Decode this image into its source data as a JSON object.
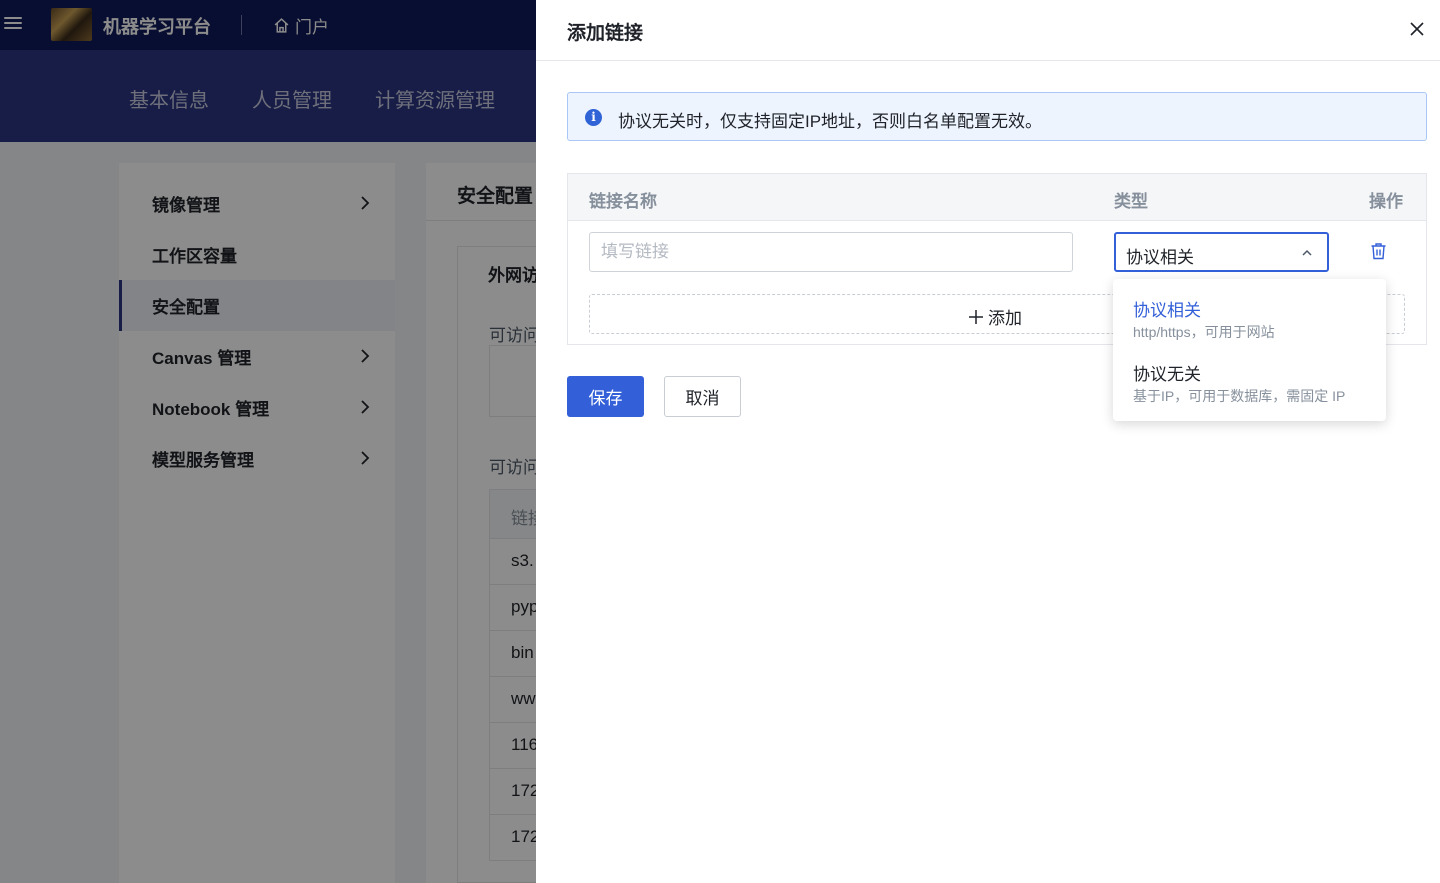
{
  "topbar": {
    "app_name": "机器学习平台",
    "portal_label": "门户"
  },
  "subnav": {
    "items": [
      "基本信息",
      "人员管理",
      "计算资源管理"
    ]
  },
  "sidebar": {
    "items": [
      {
        "label": "镜像管理",
        "has_children": true
      },
      {
        "label": "工作区容量",
        "has_children": false
      },
      {
        "label": "安全配置",
        "has_children": false,
        "active": true
      },
      {
        "label": "Canvas 管理",
        "has_children": true
      },
      {
        "label": "Notebook 管理",
        "has_children": true
      },
      {
        "label": "模型服务管理",
        "has_children": true
      }
    ]
  },
  "content": {
    "title": "安全配置",
    "card_title": "外网访",
    "label1": "可访问",
    "label2": "可访问",
    "table_header": "链接",
    "rows": [
      "s3.",
      "pyp",
      "bin",
      "ww",
      "116",
      "172",
      "172"
    ]
  },
  "drawer": {
    "title": "添加链接",
    "alert_text": "协议无关时，仅支持固定IP地址，否则白名单配置无效。",
    "columns": {
      "name": "链接名称",
      "type": "类型",
      "action": "操作"
    },
    "name_placeholder": "填写链接",
    "name_value": "",
    "type_value": "协议相关",
    "add_label": "添加",
    "save_label": "保存",
    "cancel_label": "取消",
    "options": [
      {
        "title": "协议相关",
        "desc": "http/https，可用于网站",
        "selected": true
      },
      {
        "title": "协议无关",
        "desc": "基于IP，可用于数据库，需固定 IP",
        "selected": false
      }
    ]
  },
  "colors": {
    "primary": "#3360d8",
    "topbar": "#101a5a",
    "subnav": "#2b3580"
  },
  "icons": [
    "menu-icon",
    "home-icon",
    "chevron-right-icon",
    "close-icon",
    "info-icon",
    "chevron-up-icon",
    "trash-icon",
    "plus-icon"
  ]
}
